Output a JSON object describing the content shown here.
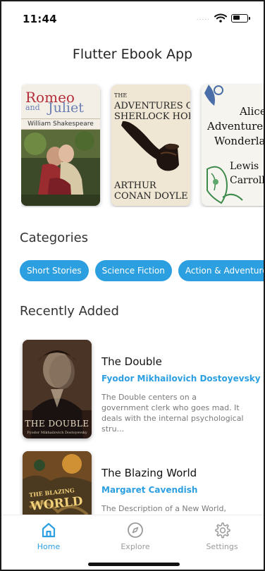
{
  "status_bar": {
    "time": "11:44",
    "signal_dots": "....."
  },
  "app": {
    "title": "Flutter Ebook App"
  },
  "featured": [
    {
      "cover_title_1": "Romeo",
      "cover_title_2": "and",
      "cover_title_3": "Juliet",
      "cover_author": "William Shakespeare"
    },
    {
      "cover_small": "THE",
      "cover_title_1": "ADVENTURES OF",
      "cover_title_2": "SHERLOCK HOLMES",
      "cover_author_1": "ARTHUR",
      "cover_author_2": "CONAN DOYLE"
    },
    {
      "cover_title_1": "Alice",
      "cover_title_2": "Adventures in",
      "cover_title_3": "Wonderland",
      "cover_author_1": "Lewis",
      "cover_author_2": "Carroll"
    }
  ],
  "categories": {
    "label": "Categories",
    "items": [
      "Short Stories",
      "Science Fiction",
      "Action & Adventure"
    ]
  },
  "recent": {
    "label": "Recently Added",
    "books": [
      {
        "title": "The Double",
        "author": "Fyodor Mikhailovich Dostoyevsky",
        "description": "The Double centers on a government clerk who goes mad. It deals with the internal psychological stru...",
        "cover_title": "THE DOUBLE",
        "cover_author": "Fyodor Mikhailovich Dostoyevsky"
      },
      {
        "title": "The Blazing World",
        "author": "Margaret Cavendish",
        "description": "The Description of a New World, Called",
        "cover_small": "THE BLAZING",
        "cover_title": "WORLD"
      }
    ]
  },
  "nav": {
    "home": "Home",
    "explore": "Explore",
    "settings": "Settings"
  },
  "colors": {
    "accent": "#2c9fe1",
    "inactive": "#9a9a9a"
  }
}
